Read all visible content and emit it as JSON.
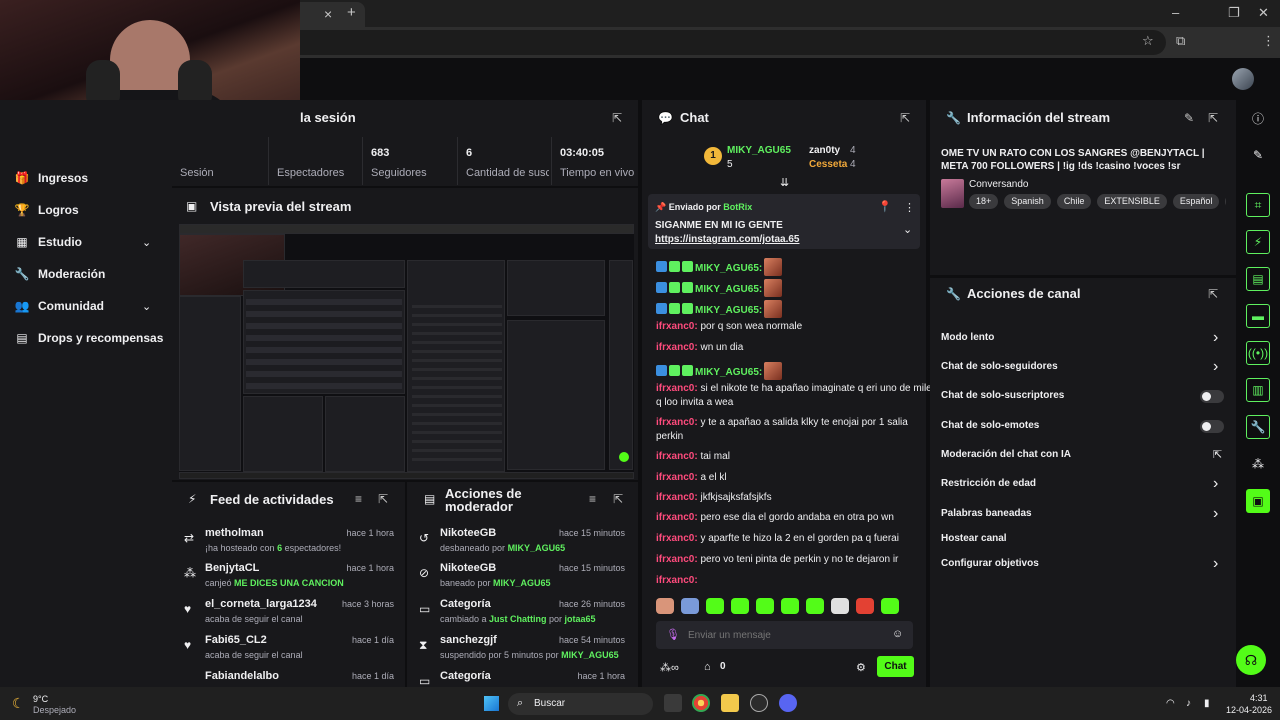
{
  "browser": {
    "tab_close": "×",
    "new_tab": "+",
    "win_min": "–",
    "win_max": "❐",
    "win_close": "✕",
    "star": "☆",
    "ext": "⧉",
    "menu": "⋮"
  },
  "nav": {
    "items": [
      {
        "icon": "🎁",
        "label": "Ingresos"
      },
      {
        "icon": "🏆",
        "label": "Logros"
      },
      {
        "icon": "▦",
        "label": "Estudio",
        "chevron": "⌄"
      },
      {
        "icon": "🔧",
        "label": "Moderación"
      },
      {
        "icon": "👥",
        "label": "Comunidad",
        "chevron": "⌄"
      },
      {
        "icon": "▤",
        "label": "Drops y recompensas"
      }
    ]
  },
  "session": {
    "title": "la sesión",
    "stats": [
      {
        "value": "",
        "label": "Sesión"
      },
      {
        "value": "",
        "label": "Espectadores"
      },
      {
        "value": "683",
        "label": "Seguidores"
      },
      {
        "value": "6",
        "label": "Cantidad de suscripciones"
      },
      {
        "value": "03:40:05",
        "label": "Tiempo en vivo"
      }
    ]
  },
  "preview": {
    "title": "Vista previa del stream"
  },
  "feed": {
    "title": "Feed de actividades",
    "items": [
      {
        "icon": "⇄",
        "name": "metholman",
        "time": "hace 1 hora",
        "sub_a": "¡ha hosteado con ",
        "sub_b": "6",
        "sub_c": " espectadores!"
      },
      {
        "icon": "⁂",
        "name": "BenjytaCL",
        "time": "hace 1 hora",
        "sub_a": "canjeó ",
        "sub_b": "ME DICES UNA CANCION",
        "sub_c": ""
      },
      {
        "icon": "♥",
        "name": "el_corneta_larga1234",
        "time": "hace 3 horas",
        "sub_a": "acaba de seguir el canal",
        "sub_b": "",
        "sub_c": ""
      },
      {
        "icon": "♥",
        "name": "Fabi65_CL2",
        "time": "hace 1 día",
        "sub_a": "acaba de seguir el canal",
        "sub_b": "",
        "sub_c": ""
      },
      {
        "icon": "",
        "name": "Fabiandelalbo",
        "time": "hace 1 día",
        "sub_a": "",
        "sub_b": "",
        "sub_c": ""
      }
    ]
  },
  "modactions": {
    "title1": "Acciones de",
    "title2": "moderador",
    "items": [
      {
        "icon": "↺",
        "name": "NikoteeGB",
        "time": "hace 15 minutos",
        "sub_a": "desbaneado por ",
        "sub_b": "MIKY_AGU65",
        "sub_c": ""
      },
      {
        "icon": "⊘",
        "name": "NikoteeGB",
        "time": "hace 15 minutos",
        "sub_a": "baneado por ",
        "sub_b": "MIKY_AGU65",
        "sub_c": ""
      },
      {
        "icon": "▭",
        "name": "Categoría",
        "time": "hace 26 minutos",
        "sub_a": "cambiado a ",
        "sub_b": "Just Chatting",
        "sub_c": " por ",
        "sub_d": "jotaa65"
      },
      {
        "icon": "⧗",
        "name": "sanchezgjf",
        "time": "hace 54 minutos",
        "sub_a": "suspendido por 5 minutos por ",
        "sub_b": "MIKY_AGU65",
        "sub_c": ""
      },
      {
        "icon": "▭",
        "name": "Categoría",
        "time": "hace 1 hora",
        "sub_a": "",
        "sub_b": "",
        "sub_c": ""
      }
    ]
  },
  "chat": {
    "title": "Chat",
    "leader": {
      "rank": "1",
      "name": "MIKY_AGU65",
      "count": "5"
    },
    "leader2": {
      "name": "zan0ty",
      "count": "4"
    },
    "leader3": {
      "name": "Cesseta",
      "count": "4"
    },
    "pinned": {
      "by": "Enviado por",
      "bot": "BotRix",
      "text": "SIGANME EN MI IG GENTE",
      "link": "https://instagram.com/jotaa.65"
    },
    "messages": [
      {
        "user": "MIKY_AGU65",
        "color": "green",
        "text": "",
        "emote": true
      },
      {
        "user": "MIKY_AGU65",
        "color": "green",
        "text": "",
        "emote": true
      },
      {
        "user": "MIKY_AGU65",
        "color": "green",
        "text": "",
        "emote": true
      },
      {
        "user": "ifrxanc0",
        "color": "pink",
        "text": "por q son wea normale"
      },
      {
        "user": "ifrxanc0",
        "color": "pink",
        "text": "wn un dia"
      },
      {
        "user": "MIKY_AGU65",
        "color": "green",
        "text": "",
        "emote": true
      },
      {
        "user": "ifrxanc0",
        "color": "pink",
        "text": "si el nikote te ha apañao imaginate q eri uno de mile"
      },
      {
        "user": "",
        "color": "none",
        "text": "q loo invita a wea"
      },
      {
        "user": "ifrxanc0",
        "color": "pink",
        "text": "y te a apañao a salida klky te enojai por 1 salia"
      },
      {
        "user": "",
        "color": "none",
        "text": "perkin"
      },
      {
        "user": "ifrxanc0",
        "color": "pink",
        "text": "tai mal"
      },
      {
        "user": "ifrxanc0",
        "color": "pink",
        "text": "a el kl"
      },
      {
        "user": "ifrxanc0",
        "color": "pink",
        "text": "jkfkjsajksfafsjkfs"
      },
      {
        "user": "ifrxanc0",
        "color": "pink",
        "text": "pero ese dia el gordo andaba en otra po wn"
      },
      {
        "user": "ifrxanc0",
        "color": "pink",
        "text": "y aparfte te hizo la 2 en el gorden pa q fuerai"
      },
      {
        "user": "ifrxanc0",
        "color": "pink",
        "text": "pero vo teni pinta de perkin y no te dejaron ir"
      },
      {
        "user": "ifrxanc0",
        "color": "pink",
        "text": ""
      }
    ],
    "input_placeholder": "Enviar un mensaje",
    "points": "0",
    "send": "Chat"
  },
  "streaminfo": {
    "title": "Información del stream",
    "stream_title": "OME TV UN RATO CON LOS SANGRES @BENJYTACL | META 700 FOLLOWERS | !ig !ds !casino !voces !sr",
    "category": "Conversando",
    "tags": [
      "18+",
      "Spanish",
      "Chile",
      "EXTENSIBLE",
      "Español",
      "c"
    ]
  },
  "channel": {
    "title": "Acciones de canal",
    "items": [
      {
        "label": "Modo lento",
        "ctl": "chevron"
      },
      {
        "label": "Chat de solo-seguidores",
        "ctl": "chevron"
      },
      {
        "label": "Chat de solo-suscriptores",
        "ctl": "toggle"
      },
      {
        "label": "Chat de solo-emotes",
        "ctl": "toggle"
      },
      {
        "label": "Moderación del chat con IA",
        "ctl": "external"
      },
      {
        "label": "Restricción de edad",
        "ctl": "chevron"
      },
      {
        "label": "Palabras baneadas",
        "ctl": "chevron"
      },
      {
        "label": "Hostear canal",
        "ctl": "none"
      },
      {
        "label": "Configurar objetivos",
        "ctl": "chevron"
      }
    ]
  },
  "taskbar": {
    "weather_temp": "9°C",
    "weather_desc": "Despejado",
    "search": "Buscar",
    "time": "4:31",
    "date": "12-04-2026"
  },
  "colors": {
    "accent": "#5ff05f",
    "kick_green": "#53fc18",
    "pink": "#ff4b7d"
  }
}
